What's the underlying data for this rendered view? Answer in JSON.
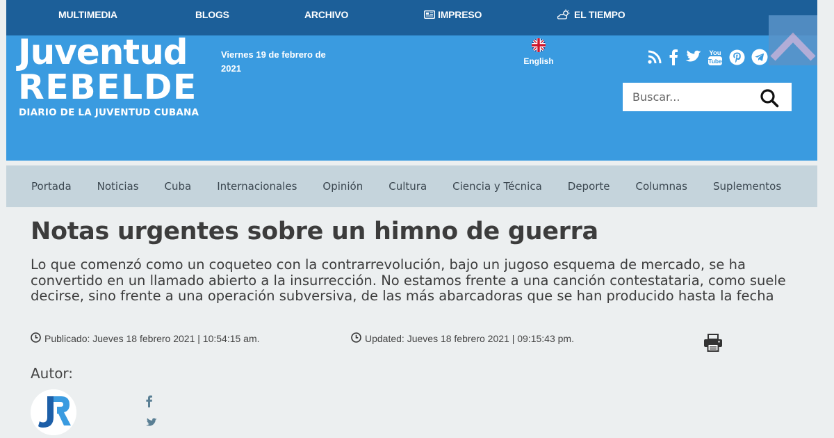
{
  "topbar": {
    "items": [
      {
        "label": "MULTIMEDIA"
      },
      {
        "label": "BLOGS"
      },
      {
        "label": "ARCHIVO"
      },
      {
        "label": "IMPRESO",
        "icon": "newspaper-icon"
      },
      {
        "label": "EL TIEMPO",
        "icon": "weather-icon"
      }
    ]
  },
  "header": {
    "logo_line1": "Juventud",
    "logo_line2": "REBELDE",
    "tagline": "DIARIO DE LA JUVENTUD CUBANA",
    "date": "Viernes 19 de febrero de 2021",
    "language": {
      "label": "English",
      "icon": "uk-flag-icon"
    },
    "social_icons": [
      "rss-icon",
      "facebook-icon",
      "twitter-icon",
      "youtube-icon",
      "pinterest-icon",
      "telegram-icon"
    ],
    "search": {
      "placeholder": "Buscar...",
      "value": ""
    }
  },
  "nav": {
    "items": [
      {
        "label": "Portada"
      },
      {
        "label": "Noticias"
      },
      {
        "label": "Cuba"
      },
      {
        "label": "Internacionales"
      },
      {
        "label": "Opinión"
      },
      {
        "label": "Cultura"
      },
      {
        "label": "Ciencia y Técnica"
      },
      {
        "label": "Deporte"
      },
      {
        "label": "Columnas"
      },
      {
        "label": "Suplementos"
      }
    ]
  },
  "article": {
    "title": "Notas urgentes sobre un himno de guerra",
    "lead": "Lo que comenzó como un coqueteo con la contrarrevolución, bajo un jugoso esquema de mercado, se ha convertido en un llamado abierto a la insurrección. No estamos frente a una canción contestataria, como suele decirse, sino frente a una operación subversiva, de las más abarcadoras que se han producido hasta la fecha",
    "published": "Publicado: Jueves 18 febrero 2021 | 10:54:15 am.",
    "updated": "Updated: Jueves 18 febrero 2021 | 09:15:43 pm.",
    "author_label": "Autor:"
  },
  "colors": {
    "topbar": "#1c5f99",
    "header": "#3a9be0",
    "nav": "#c5d4dc",
    "page": "#eceff0"
  }
}
